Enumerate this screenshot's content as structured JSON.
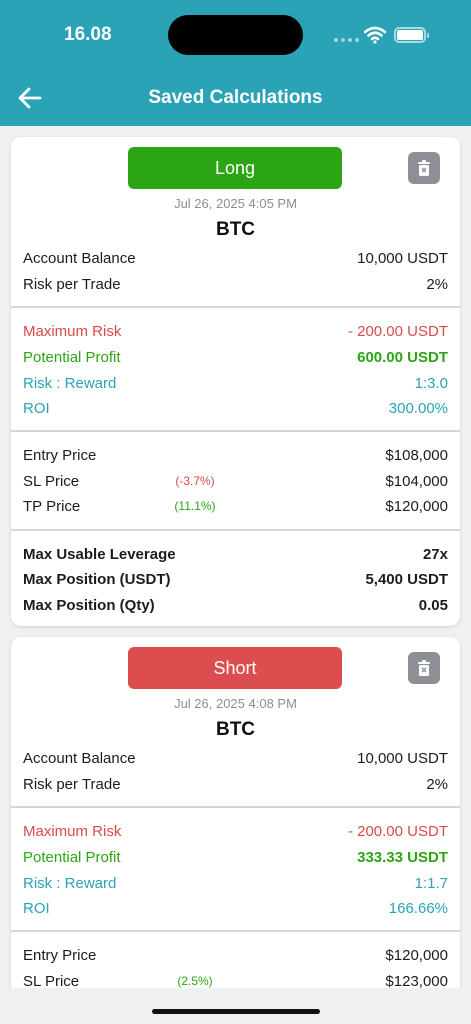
{
  "status": {
    "time": "16.08"
  },
  "nav": {
    "title": "Saved Calculations"
  },
  "cards": [
    {
      "direction": "Long",
      "date": "Jul 26, 2025  4:05 PM",
      "symbol": "BTC",
      "account_balance_label": "Account Balance",
      "account_balance": "10,000 USDT",
      "risk_per_trade_label": "Risk per Trade",
      "risk_per_trade": "2%",
      "max_risk_label": "Maximum Risk",
      "max_risk": "- 200.00 USDT",
      "potential_profit_label": "Potential Profit",
      "potential_profit": "600.00 USDT",
      "risk_reward_label": "Risk : Reward",
      "risk_reward": "1:3.0",
      "roi_label": "ROI",
      "roi": "300.00%",
      "entry_label": "Entry Price",
      "entry": "$108,000",
      "sl_label": "SL Price",
      "sl_pct": "(-3.7%)",
      "sl": "$104,000",
      "tp_label": "TP Price",
      "tp_pct": "(11.1%)",
      "tp": "$120,000",
      "lev_label": "Max Usable Leverage",
      "lev": "27x",
      "pos_usdt_label": "Max Position (USDT)",
      "pos_usdt": "5,400 USDT",
      "pos_qty_label": "Max Position (Qty)",
      "pos_qty": "0.05"
    },
    {
      "direction": "Short",
      "date": "Jul 26, 2025  4:08 PM",
      "symbol": "BTC",
      "account_balance_label": "Account Balance",
      "account_balance": "10,000 USDT",
      "risk_per_trade_label": "Risk per Trade",
      "risk_per_trade": "2%",
      "max_risk_label": "Maximum Risk",
      "max_risk": "- 200.00 USDT",
      "potential_profit_label": "Potential Profit",
      "potential_profit": "333.33 USDT",
      "risk_reward_label": "Risk : Reward",
      "risk_reward": "1:1.7",
      "roi_label": "ROI",
      "roi": "166.66%",
      "entry_label": "Entry Price",
      "entry": "$120,000",
      "sl_label": "SL Price",
      "sl_pct": "(2.5%)",
      "sl": "$123,000"
    }
  ],
  "icons": {
    "back": "arrow-left-icon",
    "delete": "trash-icon",
    "wifi": "wifi-icon",
    "battery": "battery-icon"
  },
  "colors": {
    "header": "#2aa3b6",
    "long": "#2ca514",
    "short": "#dc4d4f",
    "risk": "#d94a4a",
    "profit": "#2ca514",
    "accent": "#2aa3b6"
  }
}
